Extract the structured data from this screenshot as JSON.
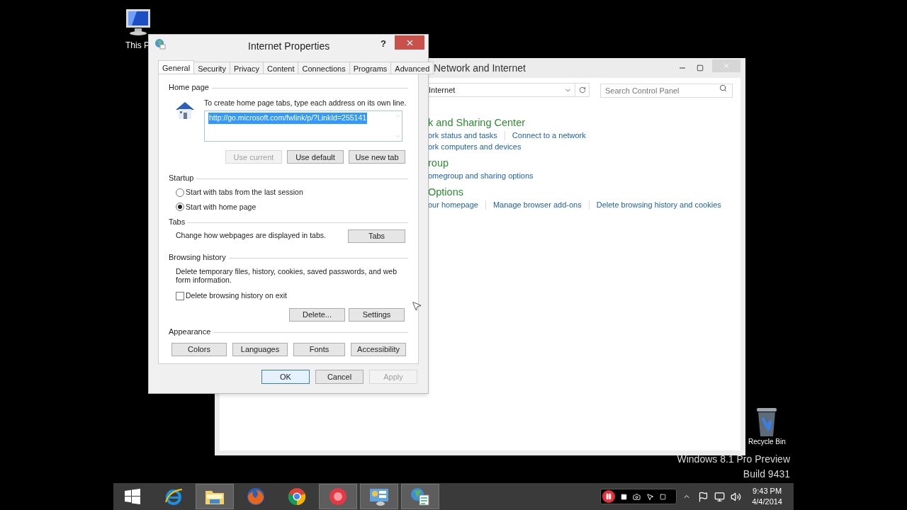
{
  "desktop_icons": [
    {
      "kind": "computer",
      "label": "This P"
    },
    {
      "kind": "recycle",
      "label": "Recycle Bin"
    }
  ],
  "desktop_watermark": [
    "Windows 8.1 Pro Preview",
    "Build 9431"
  ],
  "background_window": {
    "title": "Network and Internet",
    "address": "Internet",
    "search_placeholder": "Search Control Panel",
    "sections": [
      {
        "heading": "k and Sharing Center",
        "rows": [
          [
            "ork status and tasks",
            "Connect to a network"
          ],
          [
            "ork computers and devices"
          ]
        ]
      },
      {
        "heading": "roup",
        "rows": [
          [
            "omegroup and sharing options"
          ]
        ]
      },
      {
        "heading": "Options",
        "rows": [
          [
            "our homepage",
            "Manage browser add-ons",
            "Delete browsing history and cookies"
          ]
        ]
      }
    ]
  },
  "dialog": {
    "title": "Internet Properties",
    "help": "?",
    "tabs": [
      {
        "label": "General",
        "selected": true
      },
      {
        "label": "Security",
        "selected": false
      },
      {
        "label": "Privacy",
        "selected": false
      },
      {
        "label": "Content",
        "selected": false
      },
      {
        "label": "Connections",
        "selected": false
      },
      {
        "label": "Programs",
        "selected": false
      },
      {
        "label": "Advanced",
        "selected": false
      }
    ],
    "home_page": {
      "heading": "Home page",
      "instruction": "To create home page tabs, type each address on its own line.",
      "address": "http://go.microsoft.com/fwlink/p/?LinkId=255141",
      "buttons": [
        {
          "label": "Use current",
          "disabled": true
        },
        {
          "label": "Use default",
          "disabled": false
        },
        {
          "label": "Use new tab",
          "disabled": false
        }
      ]
    },
    "startup": {
      "heading": "Startup",
      "options": [
        {
          "label": "Start with tabs from the last session",
          "selected": false
        },
        {
          "label": "Start with home page",
          "selected": true
        }
      ]
    },
    "tabs_group": {
      "heading": "Tabs",
      "text": "Change how webpages are displayed in tabs.",
      "button": "Tabs"
    },
    "browsing_history": {
      "heading": "Browsing history",
      "text": "Delete temporary files, history, cookies, saved passwords, and web form information.",
      "checkbox": {
        "label": "Delete browsing history on exit",
        "checked": false
      },
      "buttons": [
        {
          "label": "Delete...",
          "disabled": false
        },
        {
          "label": "Settings",
          "disabled": false
        }
      ]
    },
    "appearance": {
      "heading": "Appearance",
      "buttons": [
        {
          "label": "Colors",
          "disabled": false
        },
        {
          "label": "Languages",
          "disabled": false
        },
        {
          "label": "Fonts",
          "disabled": false
        },
        {
          "label": "Accessibility",
          "disabled": false
        }
      ]
    },
    "footer_buttons": [
      {
        "label": "OK",
        "disabled": false,
        "default": true
      },
      {
        "label": "Cancel",
        "disabled": false,
        "default": false
      },
      {
        "label": "Apply",
        "disabled": true,
        "default": false
      }
    ]
  },
  "taskbar": {
    "items": [
      {
        "kind": "start",
        "running": false
      },
      {
        "kind": "ie",
        "running": false
      },
      {
        "kind": "explorer",
        "running": true
      },
      {
        "kind": "firefox",
        "running": false
      },
      {
        "kind": "chrome",
        "running": false
      },
      {
        "kind": "recorder",
        "running": true
      },
      {
        "kind": "control-panel",
        "running": true
      },
      {
        "kind": "internet-options",
        "running": true
      }
    ],
    "time": "9:43 PM",
    "date": "4/4/2014"
  }
}
